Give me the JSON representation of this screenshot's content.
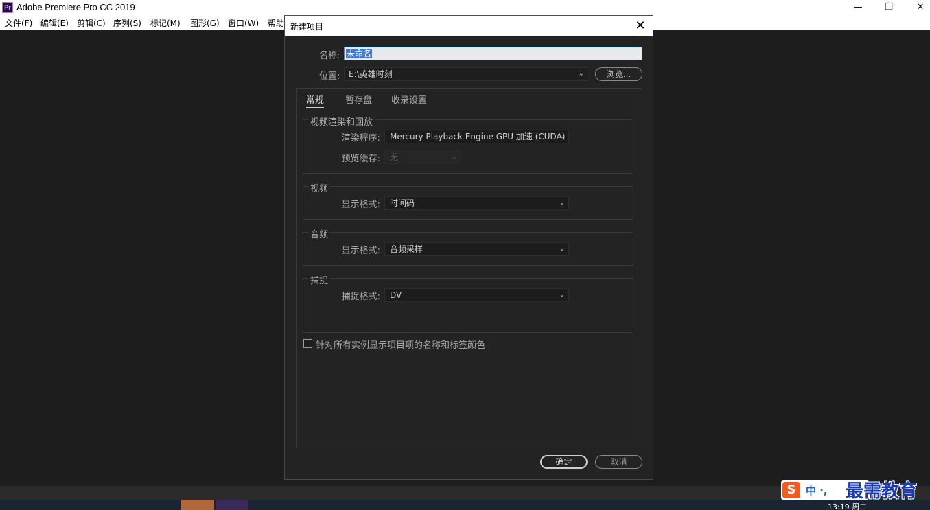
{
  "app": {
    "icon_text": "Pr",
    "title": "Adobe Premiere Pro CC 2019",
    "minimize": "—",
    "maximize": "❐",
    "close": "✕"
  },
  "menubar": {
    "items": [
      "文件(F)",
      "编辑(E)",
      "剪辑(C)",
      "序列(S)",
      "标记(M)",
      "图形(G)",
      "窗口(W)",
      "帮助"
    ]
  },
  "dialog": {
    "title": "新建项目",
    "close": "✕",
    "name_label": "名称:",
    "name_value": "未命名",
    "location_label": "位置:",
    "location_value": "E:\\英雄时刻",
    "browse_label": "浏览...",
    "tabs": [
      {
        "label": "常规",
        "active": true
      },
      {
        "label": "暂存盘",
        "active": false
      },
      {
        "label": "收录设置",
        "active": false
      }
    ],
    "groups": {
      "render": {
        "title": "视频渲染和回放",
        "renderer_label": "渲染程序:",
        "renderer_value": "Mercury Playback Engine GPU 加速 (CUDA)",
        "preview_cache_label": "预览缓存:",
        "preview_cache_value": "无"
      },
      "video": {
        "title": "视频",
        "display_format_label": "显示格式:",
        "display_format_value": "时间码"
      },
      "audio": {
        "title": "音频",
        "display_format_label": "显示格式:",
        "display_format_value": "音频采样"
      },
      "capture": {
        "title": "捕捉",
        "capture_format_label": "捕捉格式:",
        "capture_format_value": "DV"
      }
    },
    "checkbox_label": "针对所有实例显示项目项的名称和标签颜色",
    "ok_label": "确定",
    "cancel_label": "取消"
  },
  "taskbar": {
    "ime_logo": "S",
    "ime_lang": "中 ·,",
    "watermark": "最需教育",
    "clock": "13:19 周二"
  }
}
